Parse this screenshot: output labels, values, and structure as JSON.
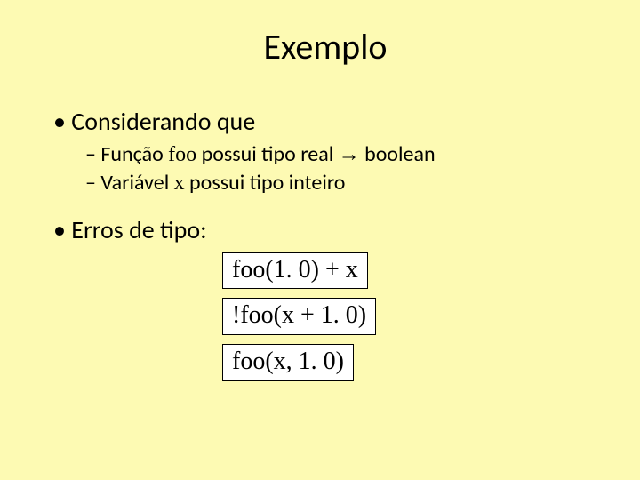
{
  "title": "Exemplo",
  "bullet1": {
    "label": "Considerando que",
    "sub1": {
      "prefix": "Função ",
      "code": "foo",
      "mid": " possui tipo real ",
      "arrow": "→",
      "suffix": " boolean"
    },
    "sub2": {
      "prefix": "Variável ",
      "code": "x",
      "suffix": " possui tipo inteiro"
    }
  },
  "bullet2": {
    "label": "Erros de tipo:"
  },
  "boxes": {
    "b1": "foo(1. 0) + x",
    "b2": "!foo(x + 1. 0)",
    "b3": "foo(x,  1. 0)"
  }
}
